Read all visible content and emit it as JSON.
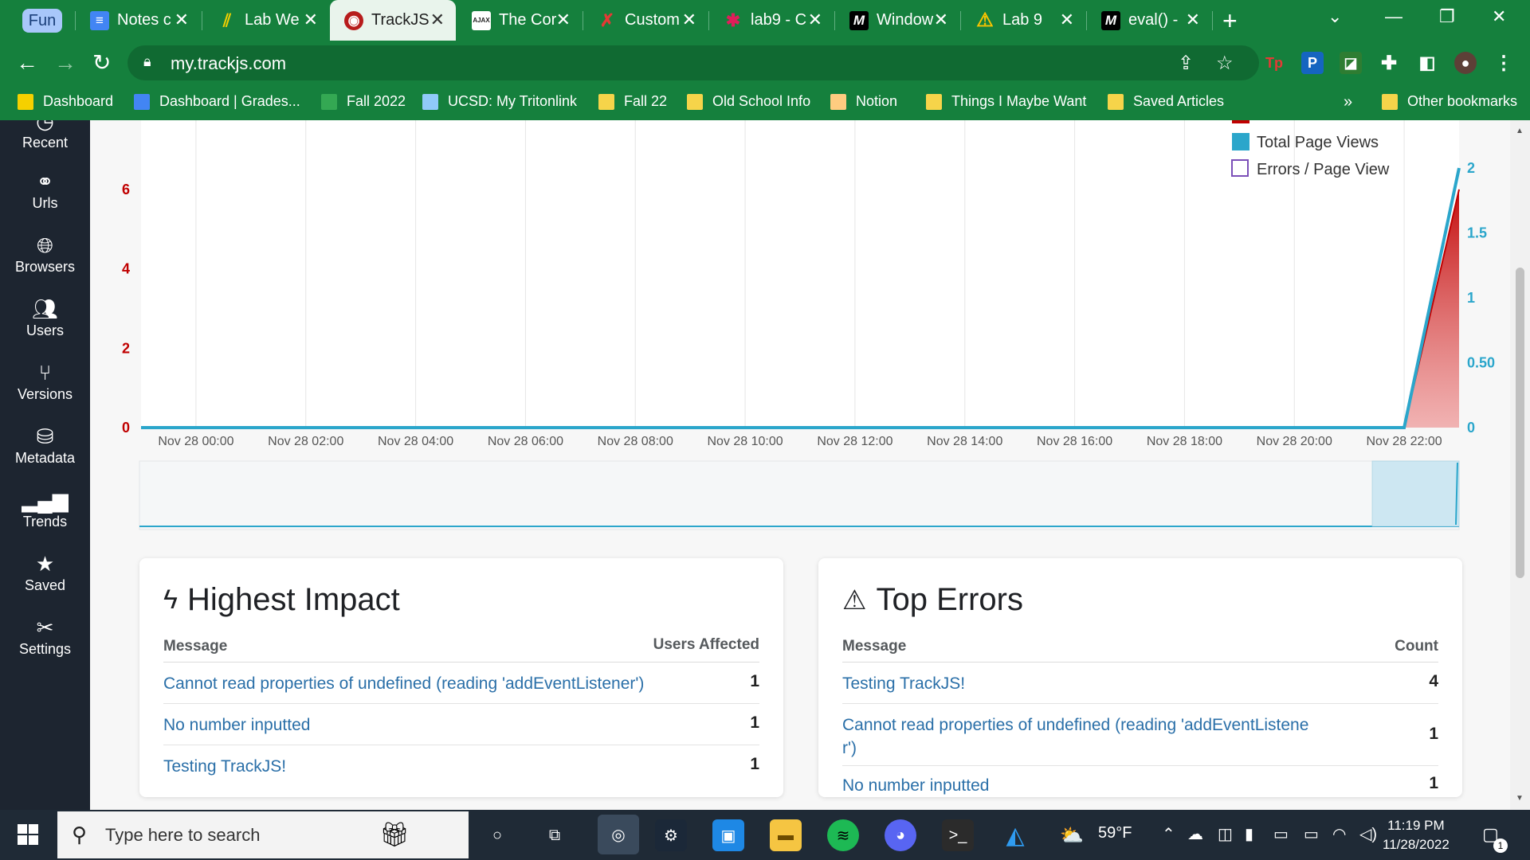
{
  "browser": {
    "tab_group_label": "Fun",
    "tabs": [
      {
        "title": "Notes c",
        "icon": "docs-icon"
      },
      {
        "title": "Lab We",
        "icon": "lab-icon"
      },
      {
        "title": "TrackJS",
        "icon": "trackjs-icon"
      },
      {
        "title": "The Cor",
        "icon": "ajax-icon"
      },
      {
        "title": "Custom",
        "icon": "custom-icon"
      },
      {
        "title": "lab9 - C",
        "icon": "slack-icon"
      },
      {
        "title": "Window",
        "icon": "mdn-icon"
      },
      {
        "title": "Lab 9",
        "icon": "warning-icon"
      },
      {
        "title": "eval() -",
        "icon": "mdn-icon"
      }
    ],
    "url": "my.trackjs.com",
    "bookmarks": [
      "Dashboard",
      "Dashboard | Grades...",
      "Fall 2022",
      "UCSD: My Tritonlink",
      "Fall 22",
      "Old School Info",
      "Notion",
      "Things I Maybe Want",
      "Saved Articles"
    ],
    "bookmarks_overflow": "»",
    "other_bookmarks": "Other bookmarks"
  },
  "sidebar": {
    "items": [
      {
        "label": "Recent",
        "icon": "clock-icon"
      },
      {
        "label": "Urls",
        "icon": "link-icon"
      },
      {
        "label": "Browsers",
        "icon": "globe-icon"
      },
      {
        "label": "Users",
        "icon": "users-icon"
      },
      {
        "label": "Versions",
        "icon": "branch-icon"
      },
      {
        "label": "Metadata",
        "icon": "database-icon"
      },
      {
        "label": "Trends",
        "icon": "bar-chart-icon"
      },
      {
        "label": "Saved",
        "icon": "star-icon"
      },
      {
        "label": "Settings",
        "icon": "tools-icon"
      }
    ]
  },
  "chart_data": {
    "type": "area",
    "x_ticks": [
      "Nov 28 00:00",
      "Nov 28 02:00",
      "Nov 28 04:00",
      "Nov 28 06:00",
      "Nov 28 08:00",
      "Nov 28 10:00",
      "Nov 28 12:00",
      "Nov 28 14:00",
      "Nov 28 16:00",
      "Nov 28 18:00",
      "Nov 28 20:00",
      "Nov 28 22:00"
    ],
    "y_left_ticks": [
      "0",
      "2",
      "4",
      "6"
    ],
    "y_left_range": [
      0,
      6.6
    ],
    "y_right_ticks": [
      "0",
      "0.50",
      "1",
      "1.5",
      "2"
    ],
    "y_right_range": [
      0,
      2
    ],
    "x_range_hours": [
      -1,
      23
    ],
    "legend_position": "top-right",
    "legend": [
      {
        "name": "Errors",
        "color": "#c00000",
        "style": "filled"
      },
      {
        "name": "Total Page Views",
        "color": "#2ba6cb",
        "style": "filled"
      },
      {
        "name": "Errors / Page View",
        "color": "#7b4fb8",
        "style": "outline"
      }
    ],
    "series": [
      {
        "name": "Errors",
        "axis": "left",
        "x": [
          -1,
          22,
          23
        ],
        "y": [
          0,
          0,
          6
        ]
      },
      {
        "name": "Total Page Views",
        "axis": "right",
        "x": [
          -1,
          22,
          23
        ],
        "y": [
          0,
          0,
          2
        ]
      }
    ],
    "colors": {
      "left_axis": "#c00000",
      "right_axis": "#2ba6cb",
      "grid": "#e6e6e6"
    }
  },
  "panels": {
    "impact": {
      "title": "Highest Impact",
      "col_message": "Message",
      "col_value": "Users Affected",
      "rows": [
        {
          "message": "Cannot read properties of undefined (reading 'addEventListener')",
          "value": "1"
        },
        {
          "message": "No number inputted",
          "value": "1"
        },
        {
          "message": "Testing TrackJS!",
          "value": "1"
        }
      ]
    },
    "errors": {
      "title": "Top Errors",
      "col_message": "Message",
      "col_value": "Count",
      "rows": [
        {
          "message": "Testing TrackJS!",
          "value": "4"
        },
        {
          "message": "Cannot read properties of undefined (reading 'addEventListene r')",
          "value": "1"
        },
        {
          "message": "No number inputted",
          "value": "1"
        }
      ]
    }
  },
  "taskbar": {
    "search_placeholder": "Type here to search",
    "weather": "59°F",
    "time": "11:19 PM",
    "date": "11/28/2022",
    "notifications": "1"
  }
}
